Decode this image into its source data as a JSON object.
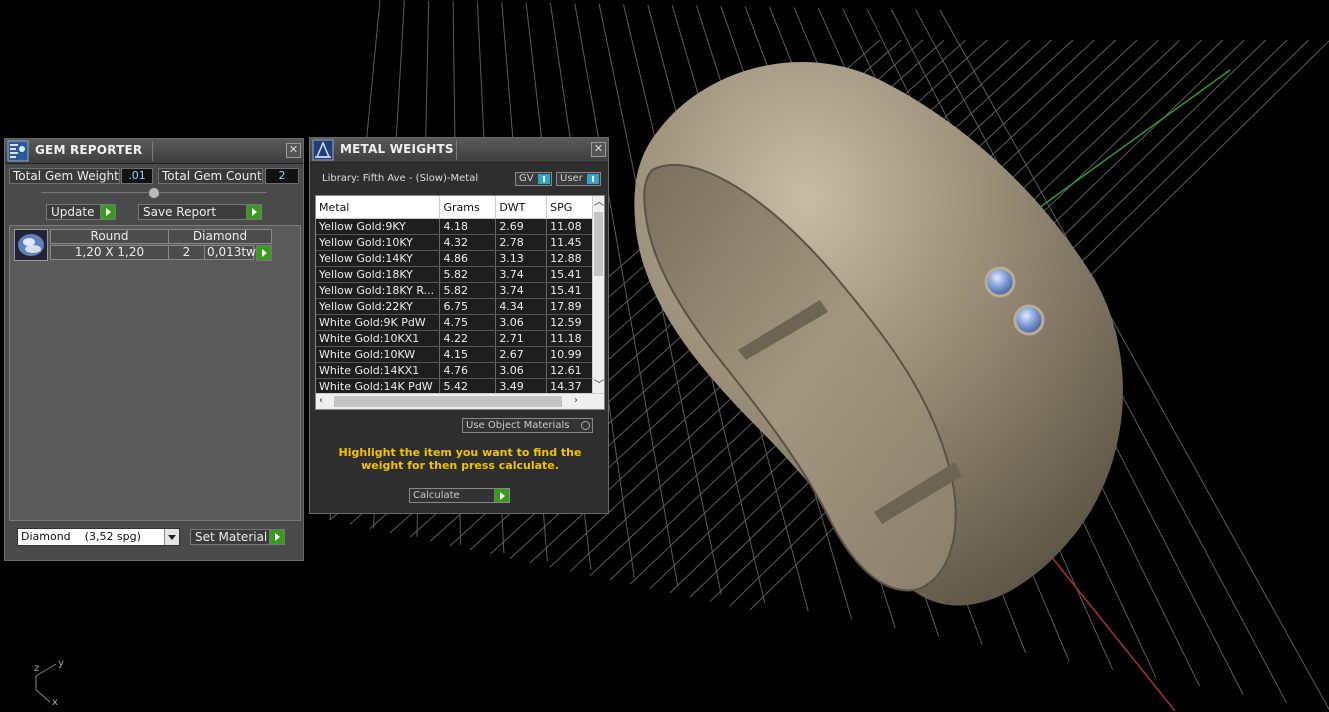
{
  "gem_reporter": {
    "title": "GEM REPORTER",
    "close": "✕",
    "total_weight_label": "Total Gem Weight",
    "total_weight_value": ".01",
    "total_count_label": "Total Gem Count",
    "total_count_value": "2",
    "update_label": "Update",
    "save_report_label": "Save Report",
    "gem_row": {
      "shape": "Round",
      "material": "Diamond",
      "size": "1,20 X 1,20",
      "count": "2",
      "weight": "0,013tw"
    },
    "material_select": "Diamond    (3,52 spg)",
    "set_material_label": "Set Material"
  },
  "metal_weights": {
    "title": "METAL WEIGHTS",
    "close": "✕",
    "library": "Library: Fifth Ave - (Slow)-Metal",
    "toggle_gv": "GV",
    "toggle_user": "User",
    "columns": [
      "Metal",
      "Grams",
      "DWT",
      "SPG"
    ],
    "rows": [
      [
        "Yellow Gold:9KY",
        "4.18",
        "2.69",
        "11.08"
      ],
      [
        "Yellow Gold:10KY",
        "4.32",
        "2.78",
        "11.45"
      ],
      [
        "Yellow Gold:14KY",
        "4.86",
        "3.13",
        "12.88"
      ],
      [
        "Yellow Gold:18KY",
        "5.82",
        "3.74",
        "15.41"
      ],
      [
        "Yellow Gold:18KY R...",
        "5.82",
        "3.74",
        "15.41"
      ],
      [
        "Yellow Gold:22KY",
        "6.75",
        "4.34",
        "17.89"
      ],
      [
        "White Gold:9K PdW",
        "4.75",
        "3.06",
        "12.59"
      ],
      [
        "White Gold:10KX1",
        "4.22",
        "2.71",
        "11.18"
      ],
      [
        "White Gold:10KW",
        "4.15",
        "2.67",
        "10.99"
      ],
      [
        "White Gold:14KX1",
        "4.76",
        "3.06",
        "12.61"
      ],
      [
        "White Gold:14K PdW",
        "5.42",
        "3.49",
        "14.37"
      ]
    ],
    "use_object_materials": "Use Object Materials",
    "hint": "Highlight the item you want to find the weight for then press calculate.",
    "calculate_label": "Calculate"
  },
  "viewport": {
    "axis_z": "z",
    "axis_y": "y",
    "axis_x": "x",
    "colors": {
      "ring": "#8a7f6c",
      "gem": "#6f8fc8",
      "grid": "#6a6a6a",
      "axis_green": "#2f9a2f",
      "axis_red": "#a83232"
    }
  }
}
